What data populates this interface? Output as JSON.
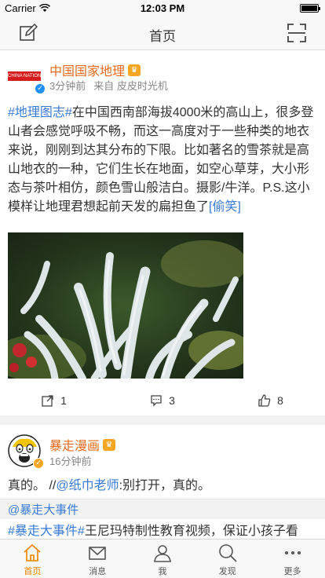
{
  "status_bar": {
    "carrier": "Carrier",
    "time": "12:03 PM",
    "battery_level": 1.0
  },
  "nav": {
    "title": "首页",
    "left_icon": "compose-icon",
    "right_icon": "scan-icon"
  },
  "posts": [
    {
      "author": "中国国家地理",
      "avatar_text": "CHINA NATIONAL GEOGRAPHY",
      "time": "3分钟前",
      "source": "来自 皮皮时光机",
      "text_parts": {
        "hashtag": "#地理图志#",
        "body": "在中国西南部海拔4000米的高山上，很多登山者会感觉呼吸不畅，而这一高度对于一些种类的地衣来说，刚刚到达其分布的下限。比如著名的雪茶就是高山地衣的一种，它们生长在地面，如空心草芽，大小形态与茶叶相仿，颜色雪山般洁白。摄影/牛洋。P.S.这小模样让地理君想起前天发的扁担鱼了",
        "emoji": "[偷笑]"
      },
      "image_alt": "雪茶",
      "actions": {
        "repost_count": "1",
        "comment_count": "3",
        "like_count": "8"
      }
    },
    {
      "author": "暴走漫画",
      "time": "16分钟前",
      "text_line1_a": "真的。 //",
      "text_line1_mention": "@纸巾老师",
      "text_line1_b": ":别打开，真的。",
      "mention": "@暴走大事件",
      "text_line3_hashtag": "#暴走大事件#",
      "text_line3_body": "王尼玛特制性教育视频，保证小孩子看"
    }
  ],
  "tabs": [
    {
      "label": "首页",
      "icon": "home-icon",
      "active": true
    },
    {
      "label": "消息",
      "icon": "message-icon",
      "active": false
    },
    {
      "label": "我",
      "icon": "profile-icon",
      "active": false
    },
    {
      "label": "发现",
      "icon": "discover-icon",
      "active": false
    },
    {
      "label": "更多",
      "icon": "more-icon",
      "active": false
    }
  ],
  "colors": {
    "accent": "#f08300",
    "link": "#3a7bd5",
    "author": "#e86b1f"
  }
}
